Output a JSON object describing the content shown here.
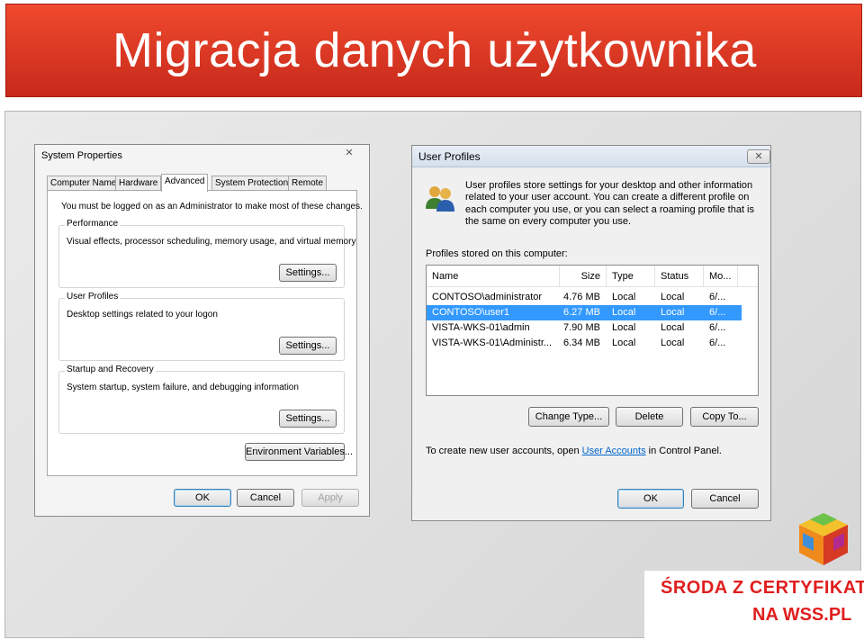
{
  "slide": {
    "title": "Migracja danych użytkownika"
  },
  "system_properties": {
    "title": "System Properties",
    "close": "✕",
    "tabs": [
      "Computer Name",
      "Hardware",
      "Advanced",
      "System Protection",
      "Remote"
    ],
    "active_tab": "Advanced",
    "admin_note": "You must be logged on as an Administrator to make most of these changes.",
    "groups": [
      {
        "label": "Performance",
        "text": "Visual effects, processor scheduling, memory usage, and virtual memory",
        "button": "Settings..."
      },
      {
        "label": "User Profiles",
        "text": "Desktop settings related to your logon",
        "button": "Settings..."
      },
      {
        "label": "Startup and Recovery",
        "text": "System startup, system failure, and debugging information",
        "button": "Settings..."
      }
    ],
    "env_button": "Environment Variables...",
    "ok": "OK",
    "cancel": "Cancel",
    "apply": "Apply"
  },
  "user_profiles": {
    "title": "User Profiles",
    "close": "✕",
    "description": "User profiles store settings for your desktop and other information related to your user account. You can create a different profile on each computer you use, or you can select a roaming profile that is the same on every computer you use.",
    "stored_label": "Profiles stored on this computer:",
    "columns": [
      "Name",
      "Size",
      "Type",
      "Status",
      "Mo..."
    ],
    "rows": [
      {
        "name": "CONTOSO\\administrator",
        "size": "4.76 MB",
        "type": "Local",
        "status": "Local",
        "modified": "6/..."
      },
      {
        "name": "CONTOSO\\user1",
        "size": "6.27 MB",
        "type": "Local",
        "status": "Local",
        "modified": "6/..."
      },
      {
        "name": "VISTA-WKS-01\\admin",
        "size": "7.90 MB",
        "type": "Local",
        "status": "Local",
        "modified": "6/..."
      },
      {
        "name": "VISTA-WKS-01\\Administr...",
        "size": "6.34 MB",
        "type": "Local",
        "status": "Local",
        "modified": "6/..."
      }
    ],
    "selected_row": 1,
    "change_type": "Change Type...",
    "delete": "Delete",
    "copy_to": "Copy To...",
    "footer_before": "To create new user accounts, open ",
    "footer_link": "User Accounts",
    "footer_after": " in Control Panel.",
    "ok": "OK",
    "cancel": "Cancel"
  },
  "branding": {
    "line1": "ŚRODA Z CERTYFIKATEM",
    "line2": "NA WSS.PL",
    "accent": "#e01e1e"
  }
}
